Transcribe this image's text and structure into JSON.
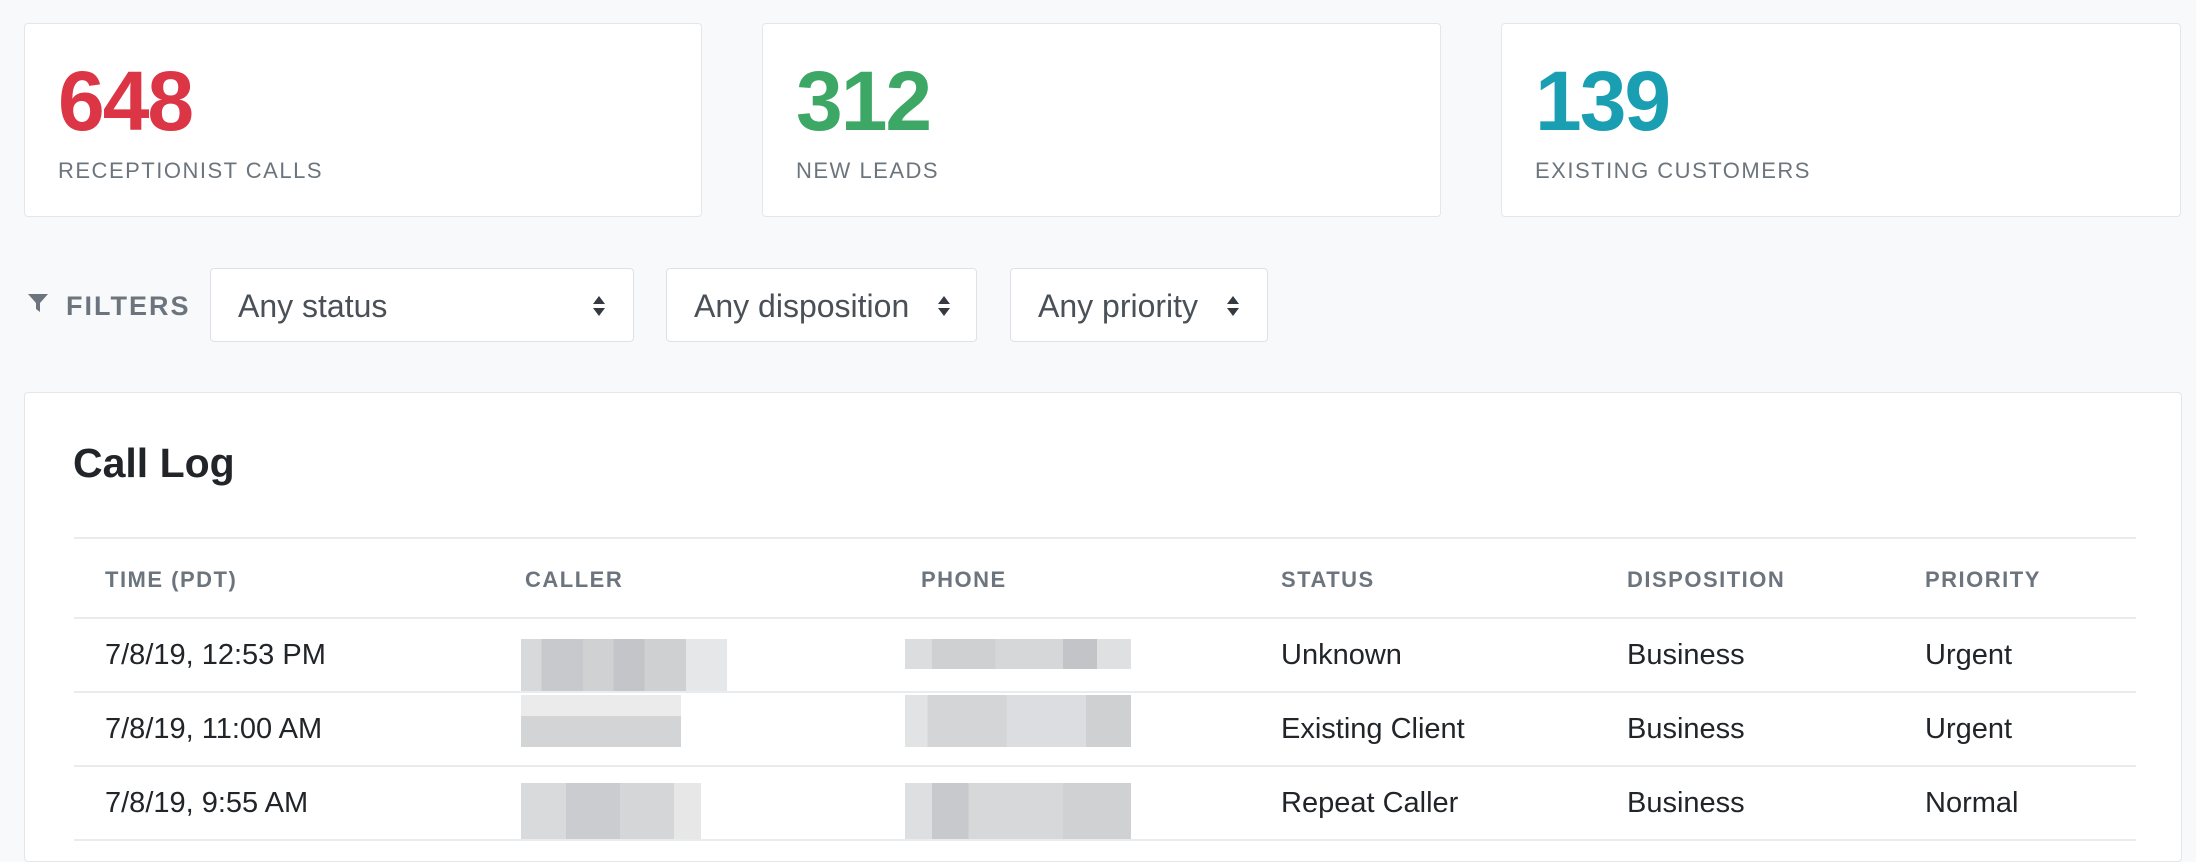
{
  "stats": [
    {
      "value": "648",
      "label": "RECEPTIONIST CALLS",
      "color": "#dc3545"
    },
    {
      "value": "312",
      "label": "NEW LEADS",
      "color": "#3da765"
    },
    {
      "value": "139",
      "label": "EXISTING CUSTOMERS",
      "color": "#1a9fb2"
    }
  ],
  "filters": {
    "label": "FILTERS",
    "icon": "filter-icon",
    "status": "Any status",
    "disposition": "Any disposition",
    "priority": "Any priority"
  },
  "call_log": {
    "title": "Call Log",
    "columns": [
      "TIME (PDT)",
      "CALLER",
      "PHONE",
      "STATUS",
      "DISPOSITION",
      "PRIORITY"
    ],
    "rows": [
      {
        "time": "7/8/19, 12:53 PM",
        "caller": "",
        "phone": "",
        "status": "Unknown",
        "disposition": "Business",
        "priority": "Urgent"
      },
      {
        "time": "7/8/19, 11:00 AM",
        "caller": "",
        "phone": "",
        "status": "Existing Client",
        "disposition": "Business",
        "priority": "Urgent"
      },
      {
        "time": "7/8/19, 9:55 AM",
        "caller": "",
        "phone": "",
        "status": "Repeat Caller",
        "disposition": "Business",
        "priority": "Normal"
      }
    ]
  }
}
